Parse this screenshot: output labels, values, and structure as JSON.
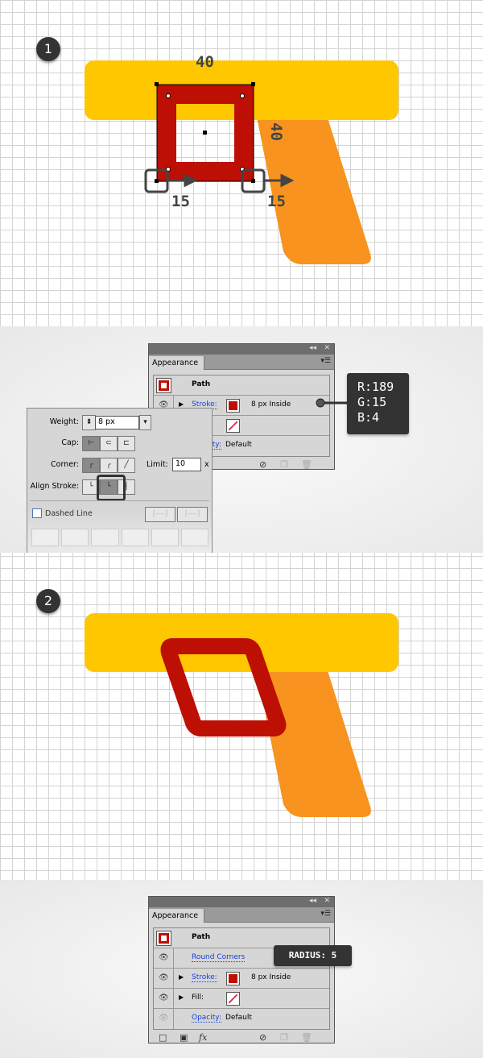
{
  "step1": {
    "badge": "1",
    "dim_top": "40",
    "dim_side": "40",
    "dim_left": "15",
    "dim_right": "15"
  },
  "step2": {
    "badge": "2"
  },
  "colors": {
    "yellow": "#ffc700",
    "orange": "#f7931e",
    "red": "#bd0f04",
    "tooltip": "#333333"
  },
  "color_tooltip": {
    "r": "R:189",
    "g": "G:15",
    "b": "B:4"
  },
  "appearance1": {
    "tab": "Appearance",
    "path": "Path",
    "stroke_label": "Stroke:",
    "stroke_value": "8 px  Inside",
    "opacity_label": "Opacity:",
    "opacity_value": "Default"
  },
  "stroke_panel": {
    "weight_label": "Weight:",
    "weight_value": "8 px",
    "cap_label": "Cap:",
    "corner_label": "Corner:",
    "limit_label": "Limit:",
    "limit_value": "10",
    "limit_unit": "x",
    "align_label": "Align Stroke:",
    "dashed_label": "Dashed Line"
  },
  "appearance2": {
    "tab": "Appearance",
    "path": "Path",
    "round_corners": "Round Corners",
    "stroke_label": "Stroke:",
    "stroke_value": "8 px  Inside",
    "fill_label": "Fill:",
    "opacity_label": "Opacity:",
    "opacity_value": "Default",
    "fx": "fx"
  },
  "radius_tooltip": "RADIUS: 5"
}
